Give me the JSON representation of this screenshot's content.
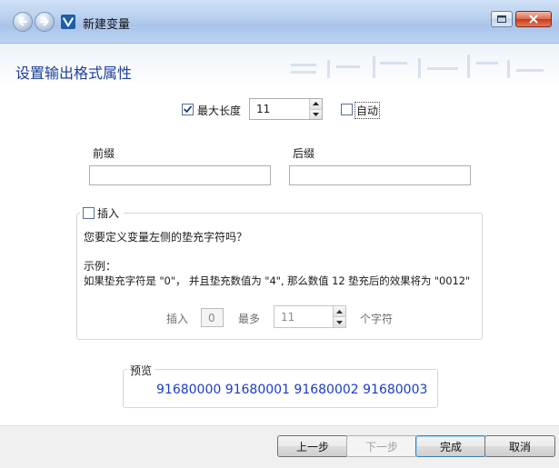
{
  "window": {
    "title": "新建变量"
  },
  "heading": "设置输出格式属性",
  "max_length": {
    "checked": true,
    "label": "最大长度",
    "value": "11"
  },
  "auto": {
    "checked": false,
    "label": "自动"
  },
  "prefix": {
    "label": "前缀",
    "value": ""
  },
  "suffix": {
    "label": "后缀",
    "value": ""
  },
  "insert": {
    "checked": false,
    "label": "插入",
    "question": "您要定义变量左侧的垫充字符吗？",
    "example_title": "示例：",
    "example_text": "如果垫充字符是 \"0\"， 并且垫充数值为 \"4\", 那么数值 12 垫充后的效果将为 \"0012\"",
    "insert_label": "插入",
    "insert_char": "0",
    "most_label": "最多",
    "most_value": "11",
    "chars_label": "个字符"
  },
  "preview": {
    "label": "预览",
    "text": "91680000 91680001 91680002 91680003"
  },
  "buttons": {
    "back": "上一步",
    "next": "下一步",
    "finish": "完成",
    "cancel": "取消"
  },
  "colors": {
    "heading": "#1d3e9a",
    "preview_text": "#1a3cc8"
  }
}
